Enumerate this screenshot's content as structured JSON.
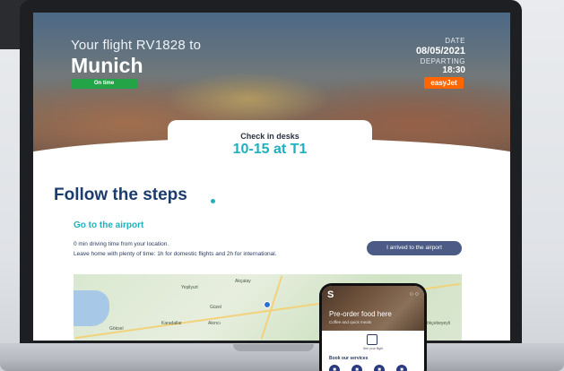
{
  "flight": {
    "line": "Your flight RV1828 to",
    "city": "Munich",
    "status": "On time",
    "date_label": "DATE",
    "date_value": "08/05/2021",
    "departing_label": "DEPARTING",
    "departing_value": "18:30",
    "airline": "easyJet"
  },
  "checkin": {
    "label": "Check in desks",
    "value": "10-15 at T1"
  },
  "steps": {
    "title": "Follow the steps",
    "section_title": "Go to the airport",
    "info_line1": "0 min driving time from your location.",
    "info_line2": "Leave home with plenty of time: 1h for domestic flights and 2h for international.",
    "arrived_button": "I arrived to the airport"
  },
  "map": {
    "labels": [
      "Akçatay",
      "Yeşilyurt",
      "Karadallar",
      "Güzel",
      "Gökçebeyeyli",
      "Akıncı",
      "Göksel"
    ]
  },
  "phone": {
    "logo": "S",
    "title": "Pre-order food here",
    "subtitle": "Coffee and quick meals",
    "qr_caption": "See your flight",
    "services_title": "Book our services"
  },
  "colors": {
    "accent": "#1fb0bf",
    "navy": "#1c3c6e",
    "button": "#4b5b86",
    "status_green": "#23a447",
    "airline_orange": "#ff6600"
  }
}
